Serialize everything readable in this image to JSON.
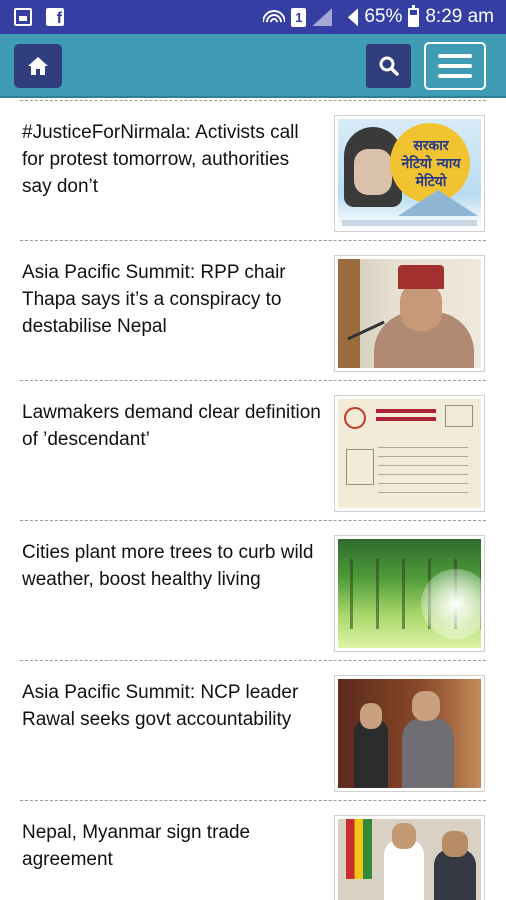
{
  "status_bar": {
    "battery": "65%",
    "time": "8:29 am",
    "sim_slot": "1",
    "icons": [
      "gallery-icon",
      "facebook-icon",
      "wifi-icon",
      "sim-icon",
      "signal-icon",
      "signal-icon",
      "battery-icon"
    ]
  },
  "toolbar": {
    "background": "#3f9cb4",
    "button_color": "#2f3d7c",
    "icons": [
      "home-icon",
      "search-icon",
      "hamburger-menu-icon"
    ]
  },
  "articles": [
    {
      "headline": "#JusticeForNirmala: Activists call for protest tomorrow, authorities say don’t",
      "thumb_text": "सरकार नेटियो न्याय मेटियो",
      "thumb_caption": "ILLUSTRATION: RAJU BABU SHAKYA/THT"
    },
    {
      "headline": "Asia Pacific Summit: RPP chair Thapa says it’s a conspiracy to destabilise Nepal"
    },
    {
      "headline": "Lawmakers demand clear definition of ’descendant’"
    },
    {
      "headline": "Cities plant more trees to curb wild weather, boost healthy living"
    },
    {
      "headline": "Asia Pacific Summit: NCP leader Rawal seeks govt accountability"
    },
    {
      "headline": "Nepal, Myanmar sign trade agreement"
    }
  ]
}
